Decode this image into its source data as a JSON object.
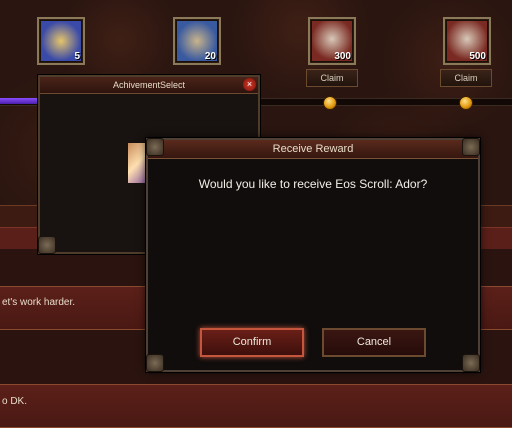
{
  "background": {
    "rewards": [
      {
        "qty": "5",
        "icon": "blue-gem-icon",
        "claim": ""
      },
      {
        "qty": "20",
        "icon": "blue-box-icon",
        "claim": ""
      },
      {
        "qty": "300",
        "icon": "red-chest-icon",
        "claim": "Claim"
      },
      {
        "qty": "500",
        "icon": "red-chest-icon",
        "claim": "Claim"
      }
    ],
    "message_lines": [
      "et's work harder.",
      "o DK."
    ]
  },
  "achievement_window": {
    "title": "AchivementSelect"
  },
  "dialog": {
    "title": "Receive Reward",
    "message": "Would you like to receive Eos Scroll: Ador?",
    "confirm_label": "Confirm",
    "cancel_label": "Cancel"
  },
  "colors": {
    "progress_fill": "#6a2fd8",
    "confirm_border": "#c4563e"
  }
}
